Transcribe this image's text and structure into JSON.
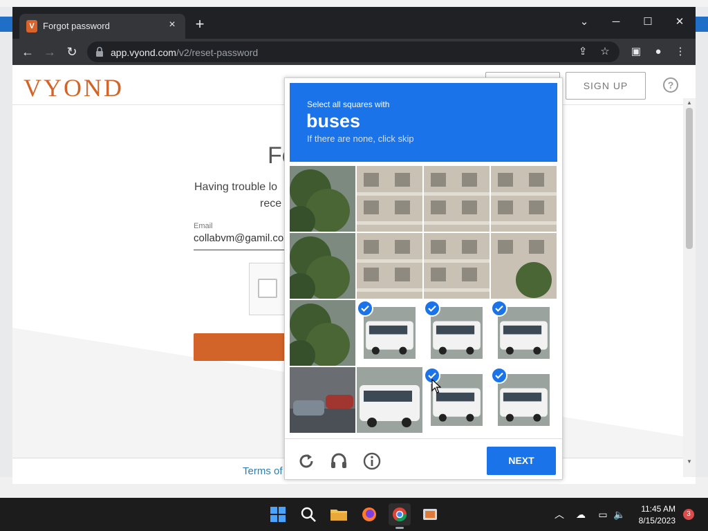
{
  "browser": {
    "tab_title": "Forgot password",
    "tab_favicon": "V",
    "url_host": "app.vyond.com",
    "url_path": "/v2/reset-password",
    "new_tab": "+",
    "close_tab": "×"
  },
  "page": {
    "logo": "VYOND",
    "signup": "SIGN UP",
    "help": "?",
    "title_partial": "Fo",
    "description_line1": "Having trouble lo",
    "description_line2": "rece",
    "email_label": "Email",
    "email_value": "collabvm@gamil.com",
    "footer_link": "Terms of"
  },
  "recaptcha": {
    "instruction": "Select all squares with",
    "target": "buses",
    "skip_hint": "If there are none, click skip",
    "next": "NEXT",
    "tiles": [
      {
        "row": 0,
        "col": 0,
        "content": "tree",
        "selected": false
      },
      {
        "row": 0,
        "col": 1,
        "content": "building",
        "selected": false
      },
      {
        "row": 0,
        "col": 2,
        "content": "building",
        "selected": false
      },
      {
        "row": 0,
        "col": 3,
        "content": "building",
        "selected": false
      },
      {
        "row": 1,
        "col": 0,
        "content": "tree",
        "selected": false
      },
      {
        "row": 1,
        "col": 1,
        "content": "building",
        "selected": false
      },
      {
        "row": 1,
        "col": 2,
        "content": "building",
        "selected": false
      },
      {
        "row": 1,
        "col": 3,
        "content": "building-tree",
        "selected": false
      },
      {
        "row": 2,
        "col": 0,
        "content": "tree",
        "selected": false
      },
      {
        "row": 2,
        "col": 1,
        "content": "bus",
        "selected": true
      },
      {
        "row": 2,
        "col": 2,
        "content": "bus",
        "selected": true
      },
      {
        "row": 2,
        "col": 3,
        "content": "bus",
        "selected": true
      },
      {
        "row": 3,
        "col": 0,
        "content": "cars",
        "selected": false
      },
      {
        "row": 3,
        "col": 1,
        "content": "bus",
        "selected": false
      },
      {
        "row": 3,
        "col": 2,
        "content": "bus",
        "selected": true
      },
      {
        "row": 3,
        "col": 3,
        "content": "bus",
        "selected": true
      }
    ]
  },
  "taskbar": {
    "time": "11:45 AM",
    "date": "8/15/2023",
    "notifications": "3"
  },
  "colors": {
    "recaptcha_blue": "#1a73e8",
    "vyond_orange": "#d2642a"
  }
}
